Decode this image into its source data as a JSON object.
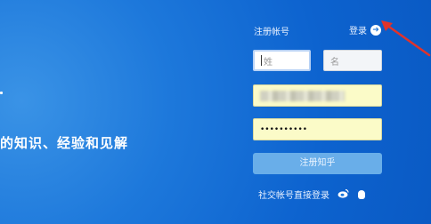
{
  "hero": {
    "tagline": "的知识、经验和见解"
  },
  "form": {
    "register_title": "注册帐号",
    "login_link": "登录",
    "surname_placeholder": "姓",
    "given_name_placeholder": "名",
    "password_value": "••••••••••",
    "submit_label": "注册知乎",
    "social_login_label": "社交帐号直接登录"
  },
  "icons": {
    "login": "arrow-right-circle-icon",
    "weibo": "weibo-icon",
    "qq": "qq-icon"
  },
  "colors": {
    "background": "#1d78db",
    "button": "#69aee9",
    "autofill": "#fbfbc8",
    "annotation_arrow": "#e0332b"
  }
}
